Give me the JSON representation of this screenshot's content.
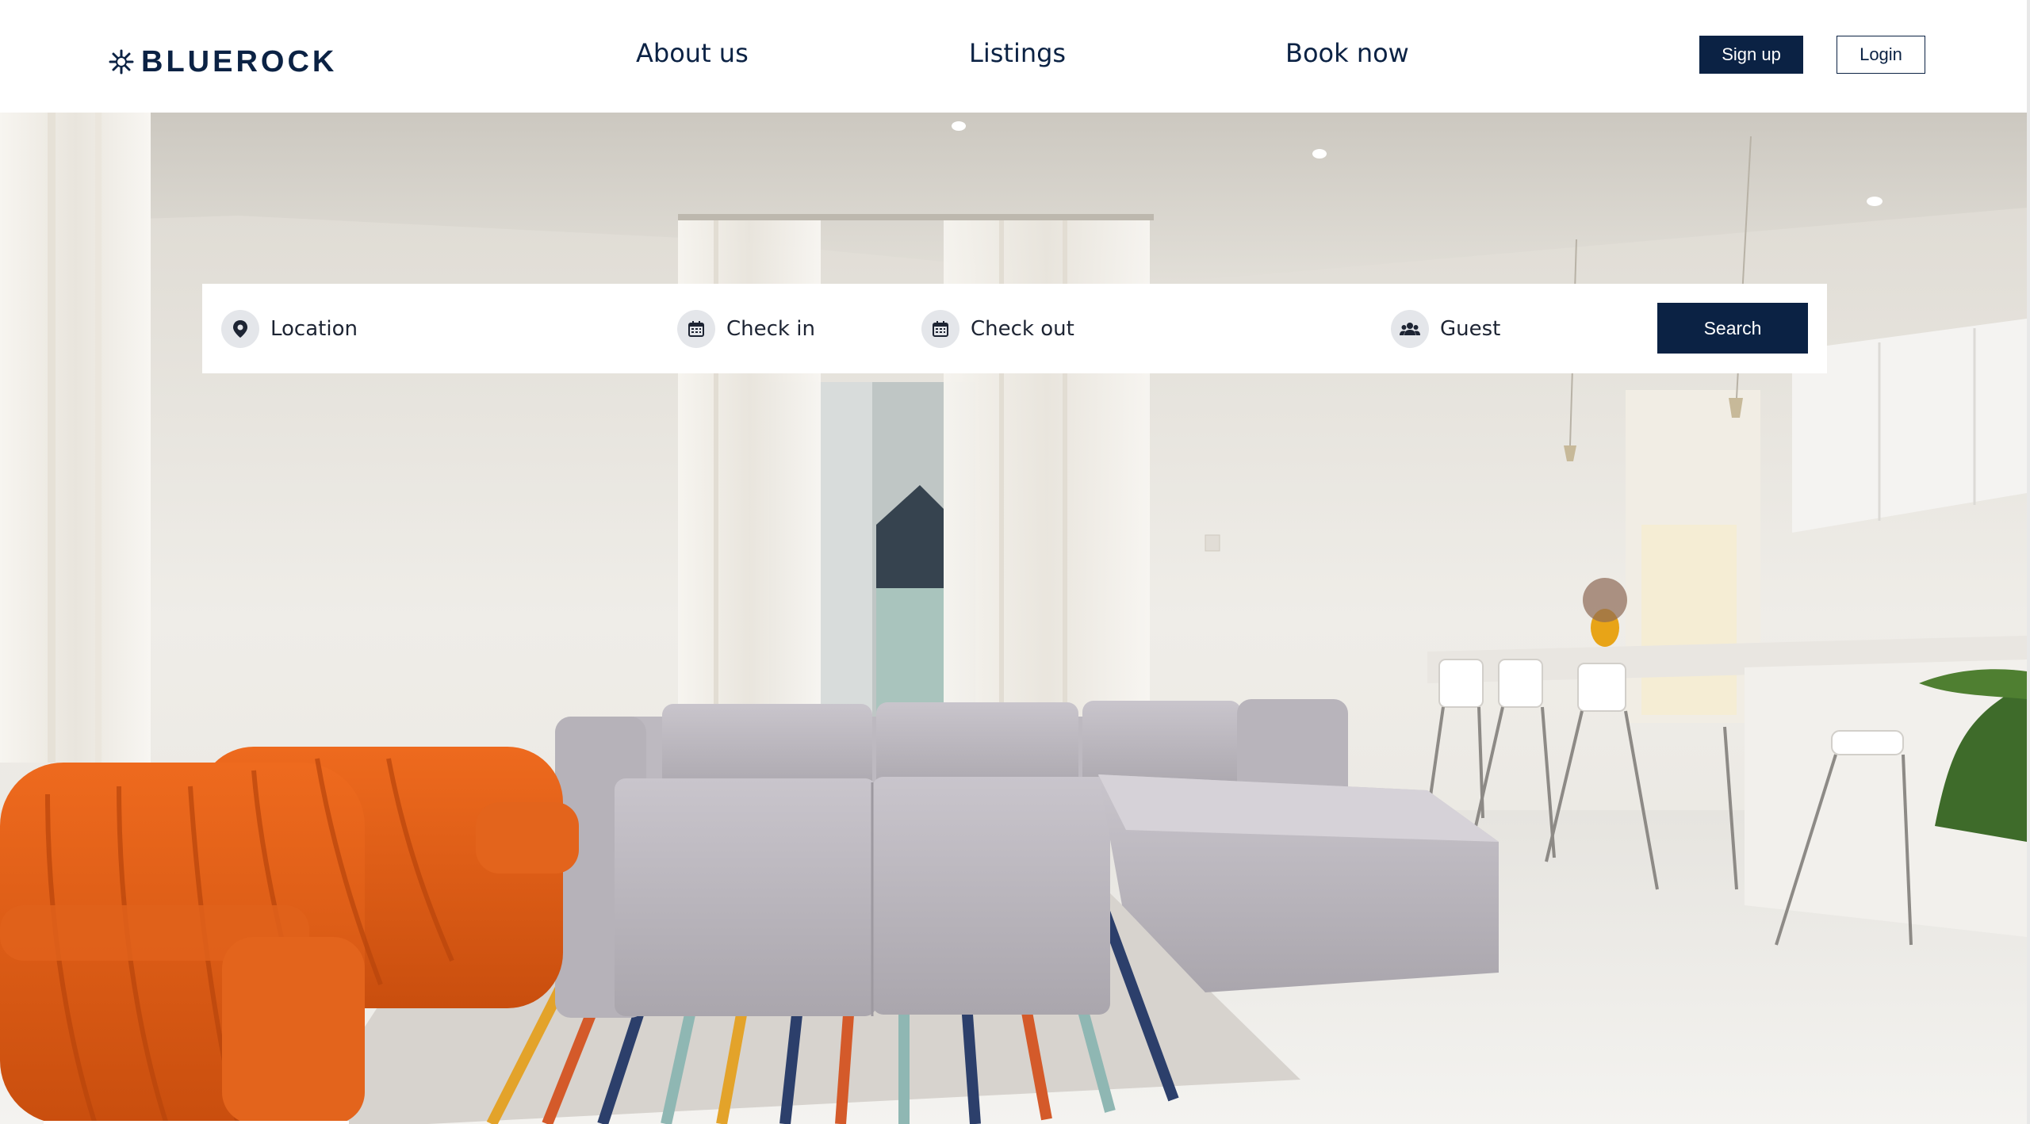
{
  "brand": {
    "name": "BLUEROCK",
    "logo_icon": "snowflake-burst-icon"
  },
  "nav": {
    "items": [
      {
        "label": "About us"
      },
      {
        "label": "Listings"
      },
      {
        "label": "Book now"
      }
    ]
  },
  "auth": {
    "signup_label": "Sign up",
    "login_label": "Login"
  },
  "search": {
    "location": {
      "label": "Location",
      "icon": "map-pin-icon"
    },
    "check_in": {
      "label": "Check in",
      "icon": "calendar-icon"
    },
    "check_out": {
      "label": "Check out",
      "icon": "calendar-icon"
    },
    "guest": {
      "label": "Guest",
      "icon": "users-icon"
    },
    "button_label": "Search"
  },
  "colors": {
    "brand_navy": "#0b2244",
    "white": "#ffffff",
    "icon_bg": "#e4e6ea"
  }
}
